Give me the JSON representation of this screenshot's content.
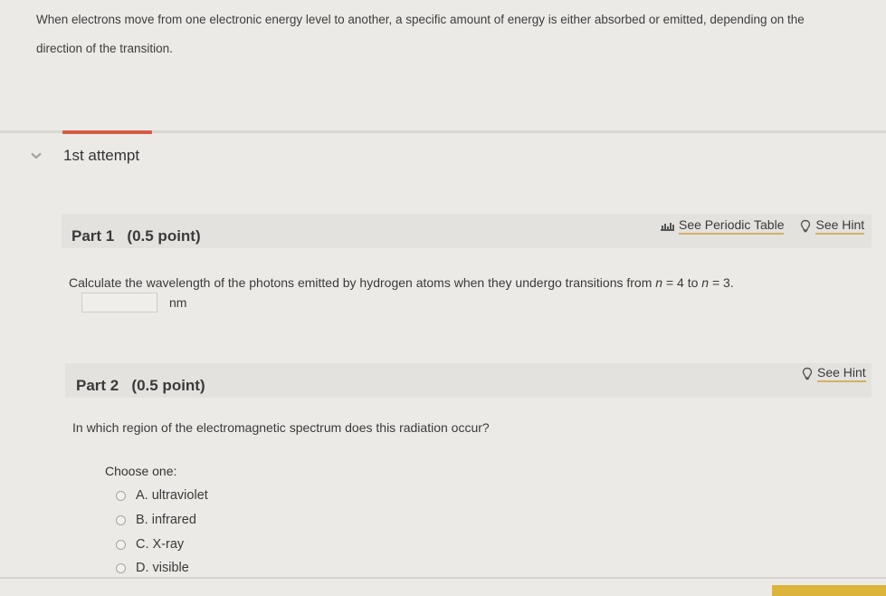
{
  "intro": {
    "text": "When electrons move from one electronic energy level to another, a specific amount of energy is either absorbed or emitted, depending on the direction of the transition."
  },
  "attempt": {
    "label": "1st attempt",
    "chevron_icon": "chevron-down-icon"
  },
  "part1": {
    "title": "Part 1   (0.5 point)",
    "periodic_table_label": "See Periodic Table",
    "hint_label": "See Hint",
    "question": "Calculate the wavelength of the photons emitted by hydrogen atoms when they undergo transitions from n = 4 to n = 3.",
    "question_parts": {
      "before": "Calculate the wavelength of the photons emitted by hydrogen atoms when they undergo transitions from ",
      "n1_var": "n",
      "n1_rest": " = 4 to ",
      "n2_var": "n",
      "n2_rest": " = 3."
    },
    "answer_value": "",
    "unit": "nm"
  },
  "part2": {
    "title": "Part 2   (0.5 point)",
    "hint_label": "See Hint",
    "question": "In which region of the electromagnetic spectrum does this radiation occur?",
    "choose_label": "Choose one:",
    "options": [
      {
        "label": "A. ultraviolet",
        "selected": false
      },
      {
        "label": "B. infrared",
        "selected": false
      },
      {
        "label": "C. X-ray",
        "selected": false
      },
      {
        "label": "D. visible",
        "selected": false
      }
    ]
  },
  "colors": {
    "accent_red": "#d65a45",
    "link_underline": "#d2b066",
    "button_yellow": "#dcb43b"
  }
}
